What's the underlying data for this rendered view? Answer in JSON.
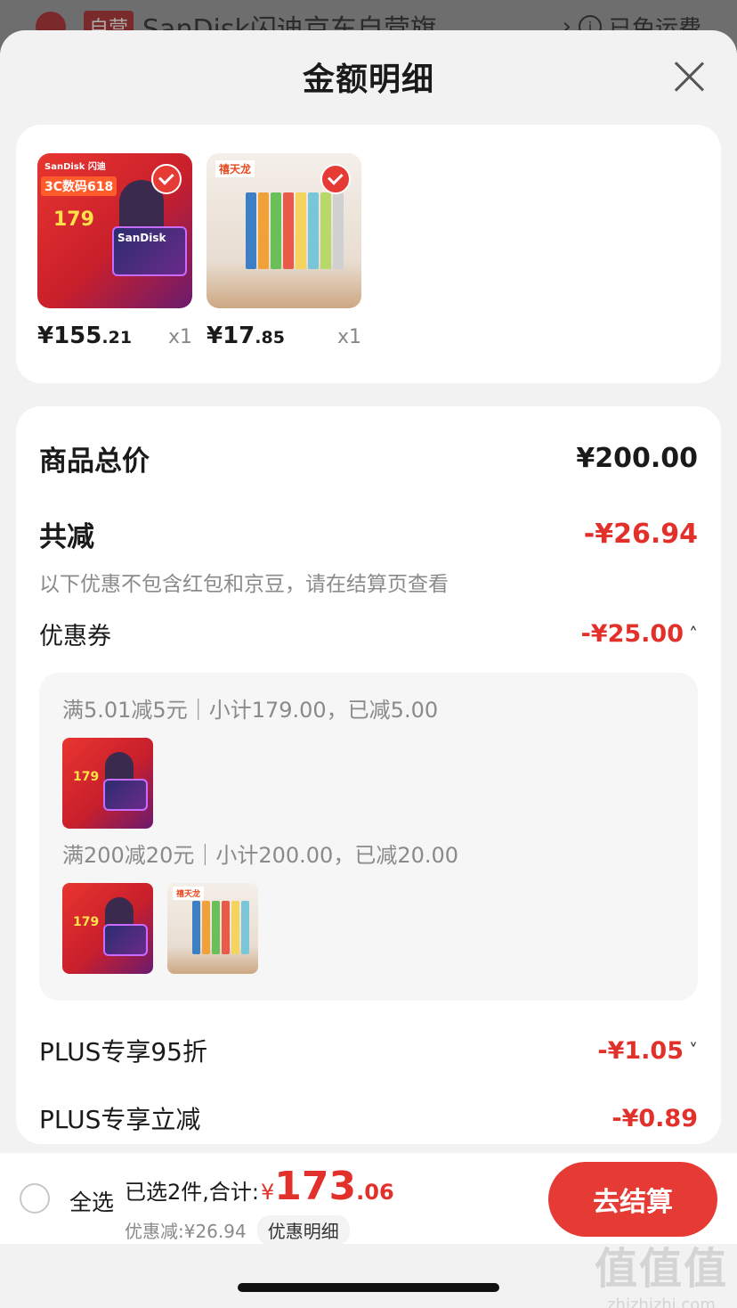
{
  "background_row": {
    "badge": "自营",
    "store_name": "SanDisk闪迪京东自营旗...",
    "chevron": "›",
    "shipping": "已免运费"
  },
  "sheet": {
    "title": "金额明细",
    "close_icon": "close-icon"
  },
  "products": [
    {
      "price_int": "¥155",
      "price_dec": ".21",
      "qty": "x1",
      "selected": true,
      "logo": "SanDisk 闪迪",
      "badge": "3C数码618",
      "promo_price": "179",
      "card_text": "SanDisk"
    },
    {
      "price_int": "¥17",
      "price_dec": ".85",
      "qty": "x1",
      "selected": true,
      "brand": "禧天龙"
    }
  ],
  "summary": {
    "total_label": "商品总价",
    "total_value": "¥200.00",
    "reduce_label": "共减",
    "reduce_value": "-¥26.94",
    "note": "以下优惠不包含红包和京豆，请在结算页查看",
    "coupon_label": "优惠券",
    "coupon_value": "-¥25.00",
    "coupon_chevron": "˄",
    "coupon_rules": [
      "满5.01减5元｜小计179.00，已减5.00",
      "满200减20元｜小计200.00，已减20.00"
    ],
    "plus1_label": "PLUS专享95折",
    "plus1_value": "-¥1.05",
    "plus1_chevron": "˅",
    "plus2_label": "PLUS专享立减",
    "plus2_value": "-¥0.89"
  },
  "footer": {
    "select_all": "全选",
    "selected_text": "已选2件,合计:",
    "yen": "¥",
    "total_int": "173",
    "total_dec": ".06",
    "discount_text": "优惠减:¥26.94",
    "detail_button": "优惠明细",
    "checkout_button": "去结算"
  },
  "watermark": {
    "big": "值值值",
    "small": "zhizhizhi.com"
  },
  "colors": {
    "accent": "#e63a35",
    "price_red": "#e2302a"
  }
}
